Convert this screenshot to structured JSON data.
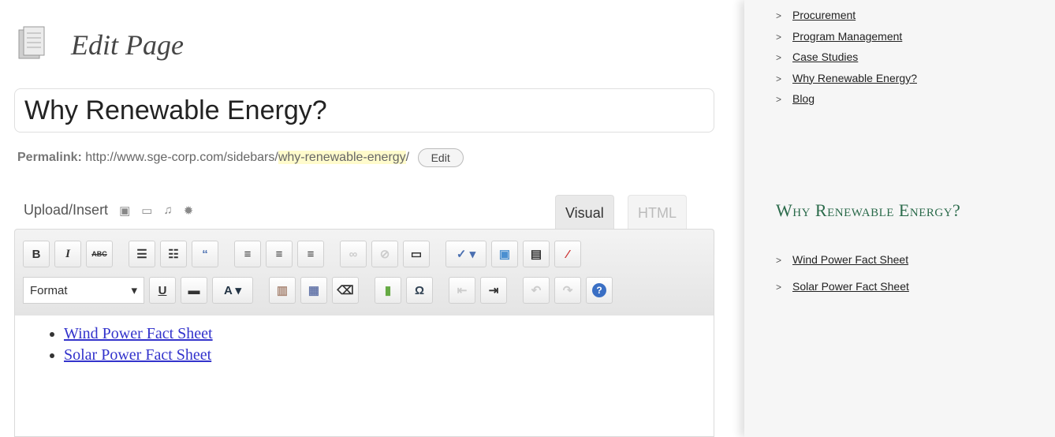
{
  "editor": {
    "page_heading": "Edit Page",
    "post_title": "Why Renewable Energy?",
    "permalink_label": "Permalink:",
    "permalink_base": "http://www.sge-corp.com/sidebars/",
    "permalink_slug": "why-renewable-energy",
    "permalink_end": "/",
    "edit_label": "Edit",
    "upload_label": "Upload/Insert",
    "media_icons": [
      "image-icon",
      "video-icon",
      "audio-icon",
      "media-icon"
    ],
    "tabs": {
      "visual": "Visual",
      "html": "HTML"
    },
    "format_label": "Format",
    "toolbar_row1": [
      {
        "name": "bold-button",
        "glyph": "B"
      },
      {
        "name": "italic-button",
        "glyph": "I"
      },
      {
        "name": "strikethrough-button",
        "glyph": "ABC"
      },
      {
        "name": "bullet-list-button",
        "glyph": "☰"
      },
      {
        "name": "numbered-list-button",
        "glyph": "☷"
      },
      {
        "name": "blockquote-button",
        "glyph": "“"
      },
      {
        "name": "align-left-button",
        "glyph": "≡"
      },
      {
        "name": "align-center-button",
        "glyph": "≡"
      },
      {
        "name": "align-right-button",
        "glyph": "≡"
      },
      {
        "name": "insert-link-button",
        "glyph": "∞"
      },
      {
        "name": "unlink-button",
        "glyph": "⊘"
      },
      {
        "name": "more-tag-button",
        "glyph": "▭"
      },
      {
        "name": "spellcheck-button",
        "glyph": "✓"
      },
      {
        "name": "fullscreen-button",
        "glyph": "▣"
      },
      {
        "name": "kitchen-sink-button",
        "glyph": "▤"
      },
      {
        "name": "draft-mode-button",
        "glyph": "⁄"
      }
    ],
    "toolbar_row2": [
      {
        "name": "underline-button",
        "glyph": "U"
      },
      {
        "name": "justify-button",
        "glyph": "▬"
      },
      {
        "name": "text-color-button",
        "glyph": "A"
      },
      {
        "name": "paste-text-button",
        "glyph": "▥"
      },
      {
        "name": "paste-word-button",
        "glyph": "▦"
      },
      {
        "name": "remove-format-button",
        "glyph": "⌫"
      },
      {
        "name": "insert-media-button",
        "glyph": "▮"
      },
      {
        "name": "special-char-button",
        "glyph": "Ω"
      },
      {
        "name": "outdent-button",
        "glyph": "⇤"
      },
      {
        "name": "indent-button",
        "glyph": "⇥"
      },
      {
        "name": "undo-button",
        "glyph": "↶"
      },
      {
        "name": "redo-button",
        "glyph": "↷"
      },
      {
        "name": "help-button",
        "glyph": "?"
      }
    ],
    "content_links": [
      "Wind Power Fact Sheet",
      "Solar Power Fact Sheet"
    ]
  },
  "sidebar": {
    "nav_links": [
      "Procurement",
      "Program Management",
      "Case Studies",
      "Why Renewable Energy?",
      "Blog"
    ],
    "heading": "Why Renewable Energy?",
    "section_links": [
      "Wind Power Fact Sheet",
      "Solar Power Fact Sheet"
    ]
  },
  "colors": {
    "link": "#3333cc",
    "sidebar_heading": "#2a6a4a",
    "slug_highlight": "#fffbcc"
  }
}
